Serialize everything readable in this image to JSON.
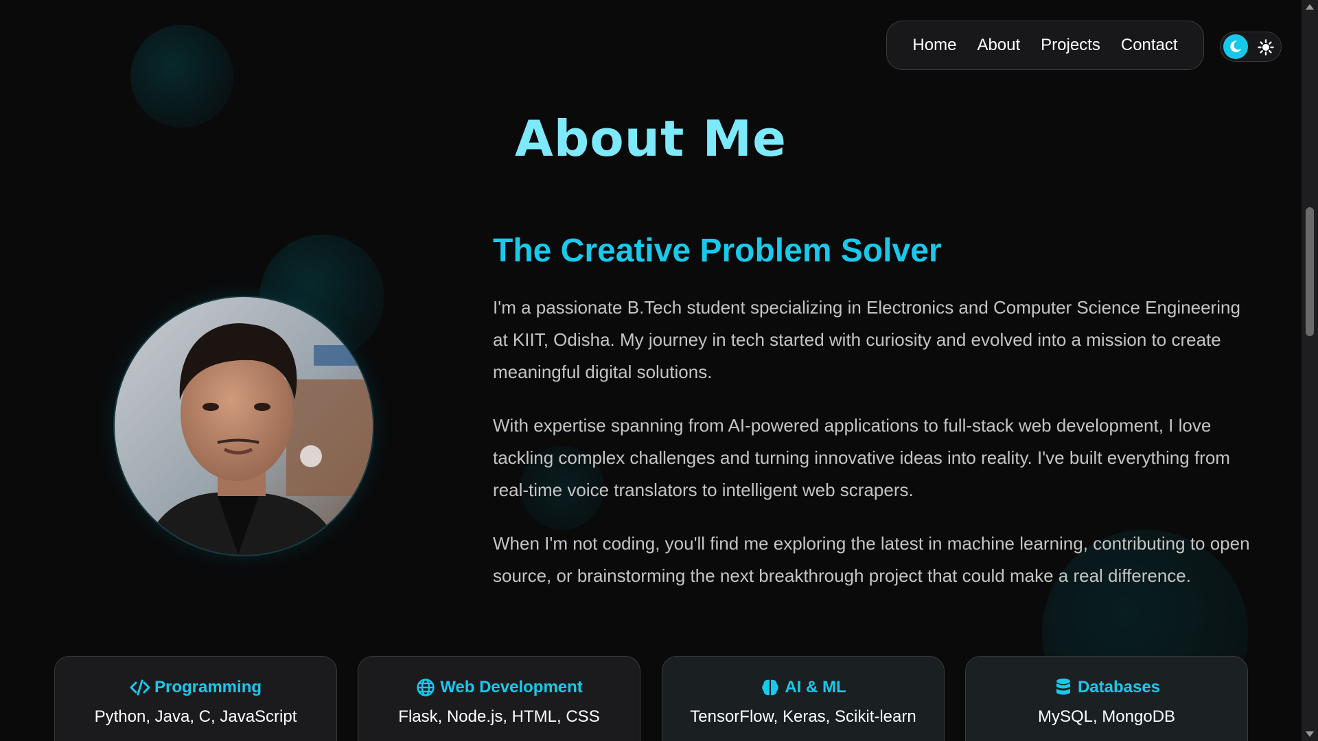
{
  "nav": {
    "items": [
      "Home",
      "About",
      "Projects",
      "Contact"
    ]
  },
  "theme_toggle": {
    "active": "dark",
    "icons": [
      "moon-icon",
      "sun-icon"
    ],
    "accent": "#18c8ea"
  },
  "about": {
    "title": "About Me",
    "subtitle": "The Creative Problem Solver",
    "paragraphs": [
      "I'm a passionate B.Tech student specializing in Electronics and Computer Science Engineering at KIIT, Odisha. My journey in tech started with curiosity and evolved into a mission to create meaningful digital solutions.",
      "With expertise spanning from AI-powered applications to full-stack web development, I love tackling complex challenges and turning innovative ideas into reality. I've built everything from real-time voice translators to intelligent web scrapers.",
      "When I'm not coding, you'll find me exploring the latest in machine learning, contributing to open source, or brainstorming the next breakthrough project that could make a real difference."
    ]
  },
  "skills": [
    {
      "icon": "code-icon",
      "title": "Programming",
      "items": "Python, Java, C, JavaScript"
    },
    {
      "icon": "globe-icon",
      "title": "Web Development",
      "items": "Flask, Node.js, HTML, CSS"
    },
    {
      "icon": "brain-icon",
      "title": "AI & ML",
      "items": "TensorFlow, Keras, Scikit-learn"
    },
    {
      "icon": "database-icon",
      "title": "Databases",
      "items": "MySQL, MongoDB"
    }
  ],
  "colors": {
    "background": "#0a0a0b",
    "accent": "#19c9ec",
    "title": "#7de9fb"
  }
}
